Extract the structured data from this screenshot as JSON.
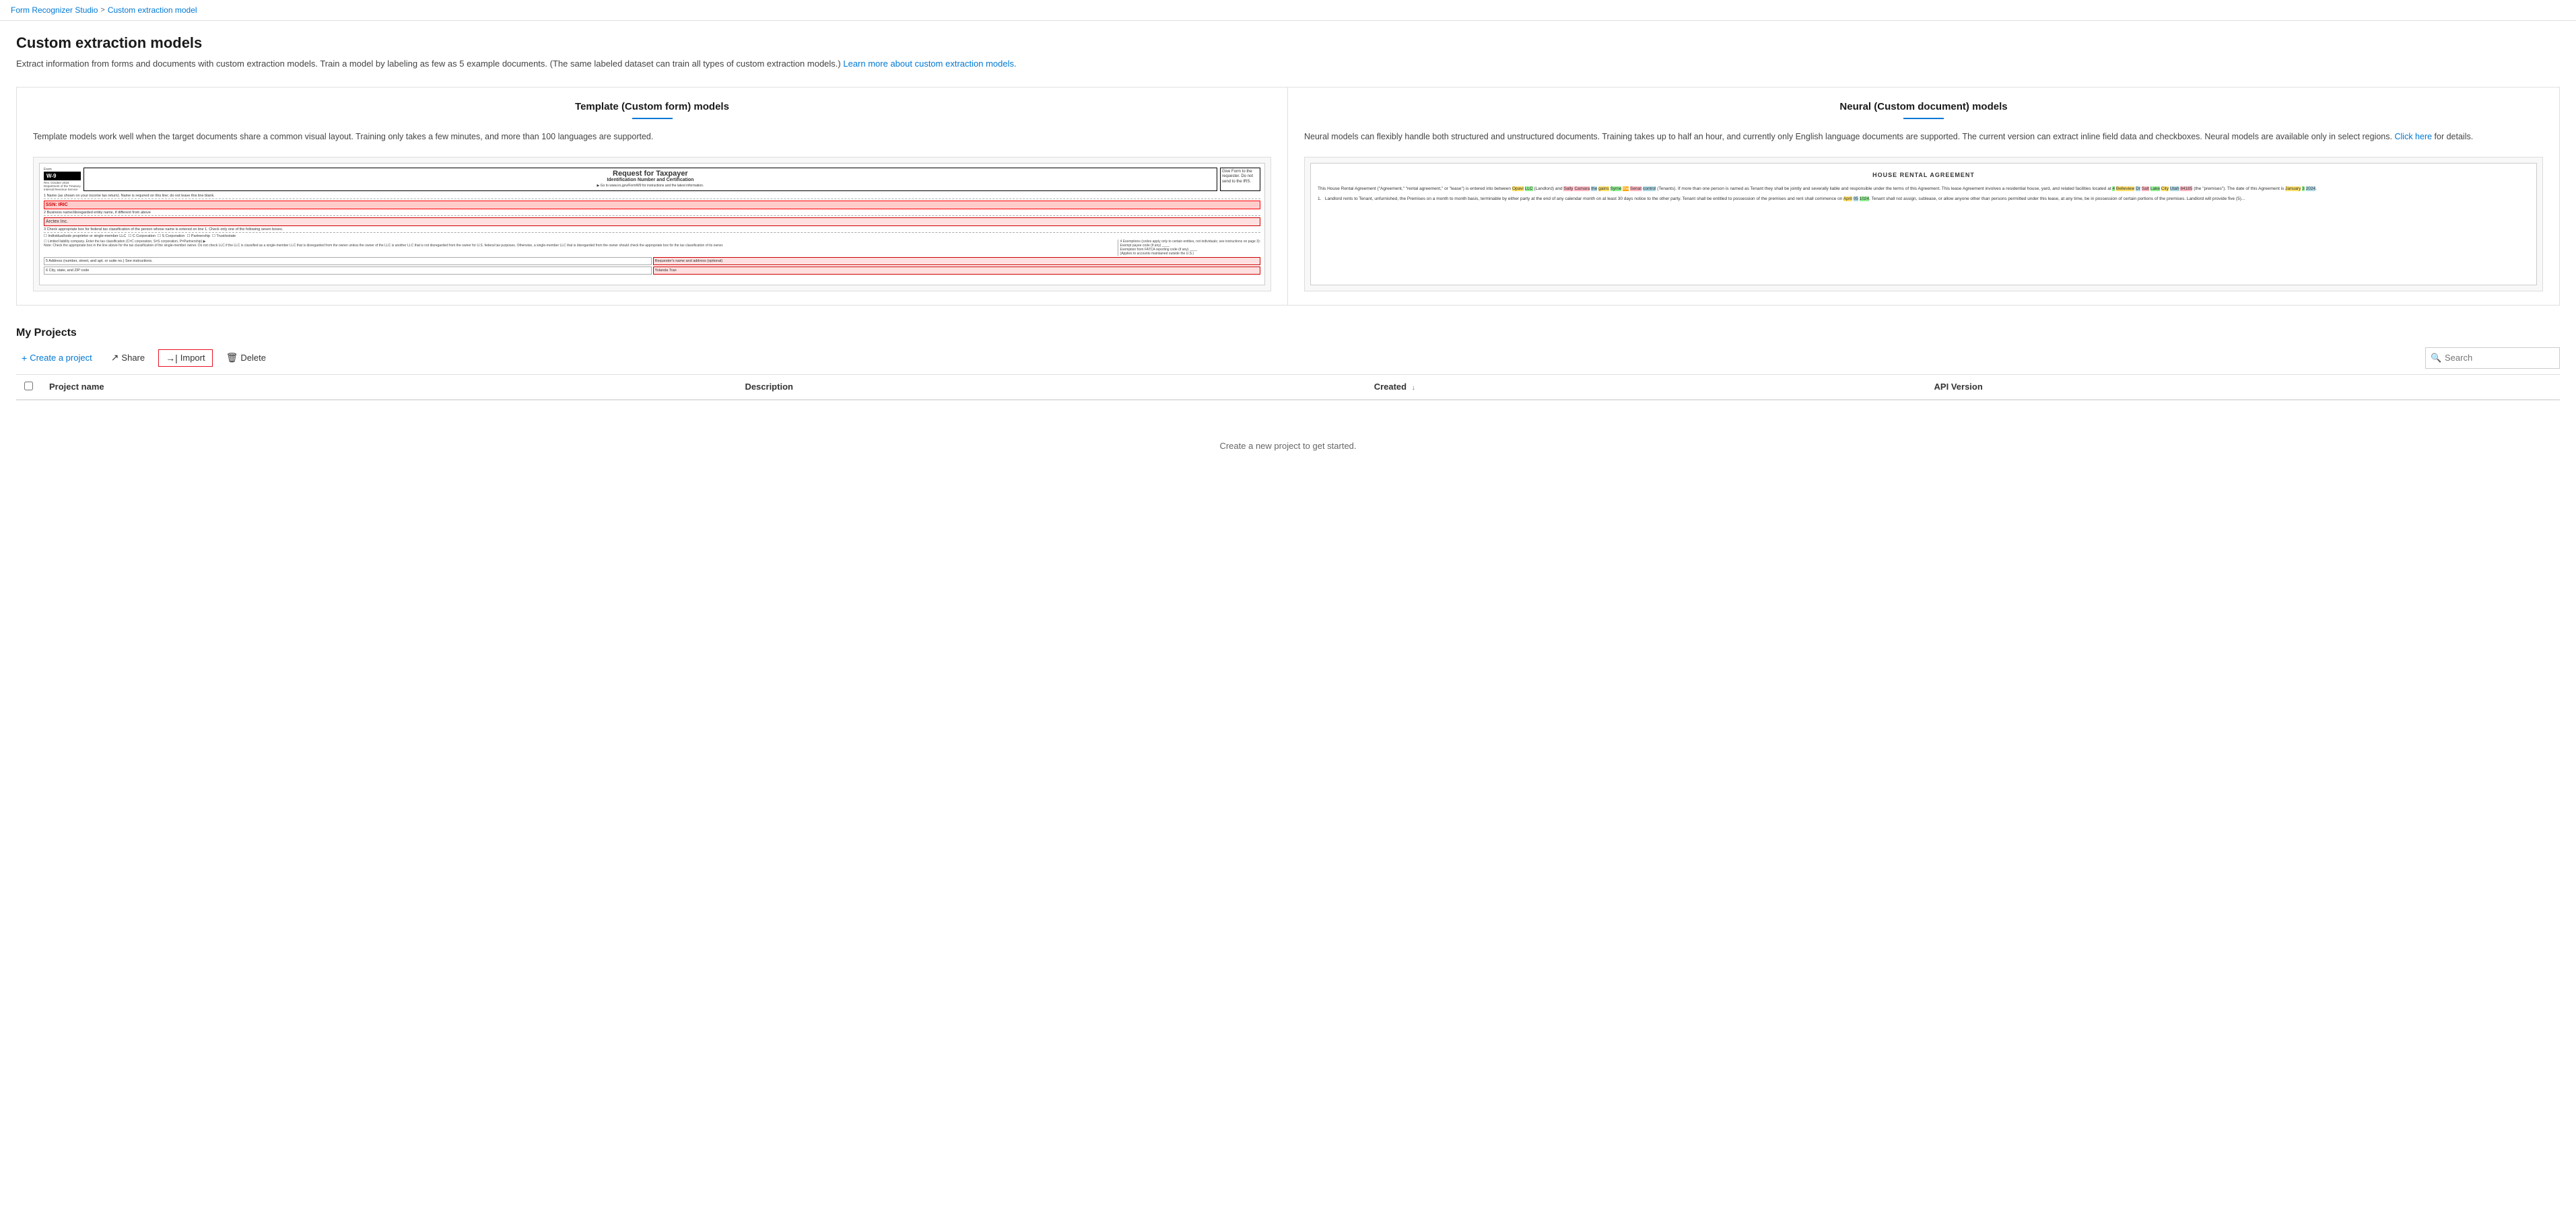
{
  "breadcrumb": {
    "parent_label": "Form Recognizer Studio",
    "parent_url": "#",
    "separator": ">",
    "current": "Custom extraction model"
  },
  "page": {
    "title": "Custom extraction models",
    "description": "Extract information from forms and documents with custom extraction models. Train a model by labeling as few as 5 example documents. (The same labeled dataset can train all types of custom extraction models.)",
    "learn_more_text": "Learn more about custom extraction models.",
    "learn_more_url": "#"
  },
  "model_cards": [
    {
      "id": "template",
      "title": "Template (Custom form) models",
      "description": "Template models work well when the target documents share a common visual layout. Training only takes a few minutes, and more than 100 languages are supported."
    },
    {
      "id": "neural",
      "title": "Neural (Custom document) models",
      "description": "Neural models can flexibly handle both structured and unstructured documents. Training takes up to half an hour, and currently only English language documents are supported. The current version can extract inline field data and checkboxes. Neural models are available only in select regions.",
      "link_text": "Click here",
      "link_url": "#",
      "link_suffix": "for details."
    }
  ],
  "projects": {
    "section_title": "My Projects",
    "toolbar": {
      "create_label": "Create a project",
      "share_label": "Share",
      "import_label": "Import",
      "delete_label": "Delete"
    },
    "search_placeholder": "Search",
    "table": {
      "columns": [
        {
          "id": "project_name",
          "label": "Project name"
        },
        {
          "id": "description",
          "label": "Description"
        },
        {
          "id": "created",
          "label": "Created",
          "sortable": true,
          "sort_icon": "↓"
        },
        {
          "id": "api_version",
          "label": "API Version"
        }
      ],
      "rows": []
    },
    "empty_state": "Create a new project to get started."
  },
  "icons": {
    "plus": "+",
    "share": "↗",
    "import": "→|",
    "delete": "🗑",
    "search": "🔍",
    "chevron_down": "↓"
  }
}
